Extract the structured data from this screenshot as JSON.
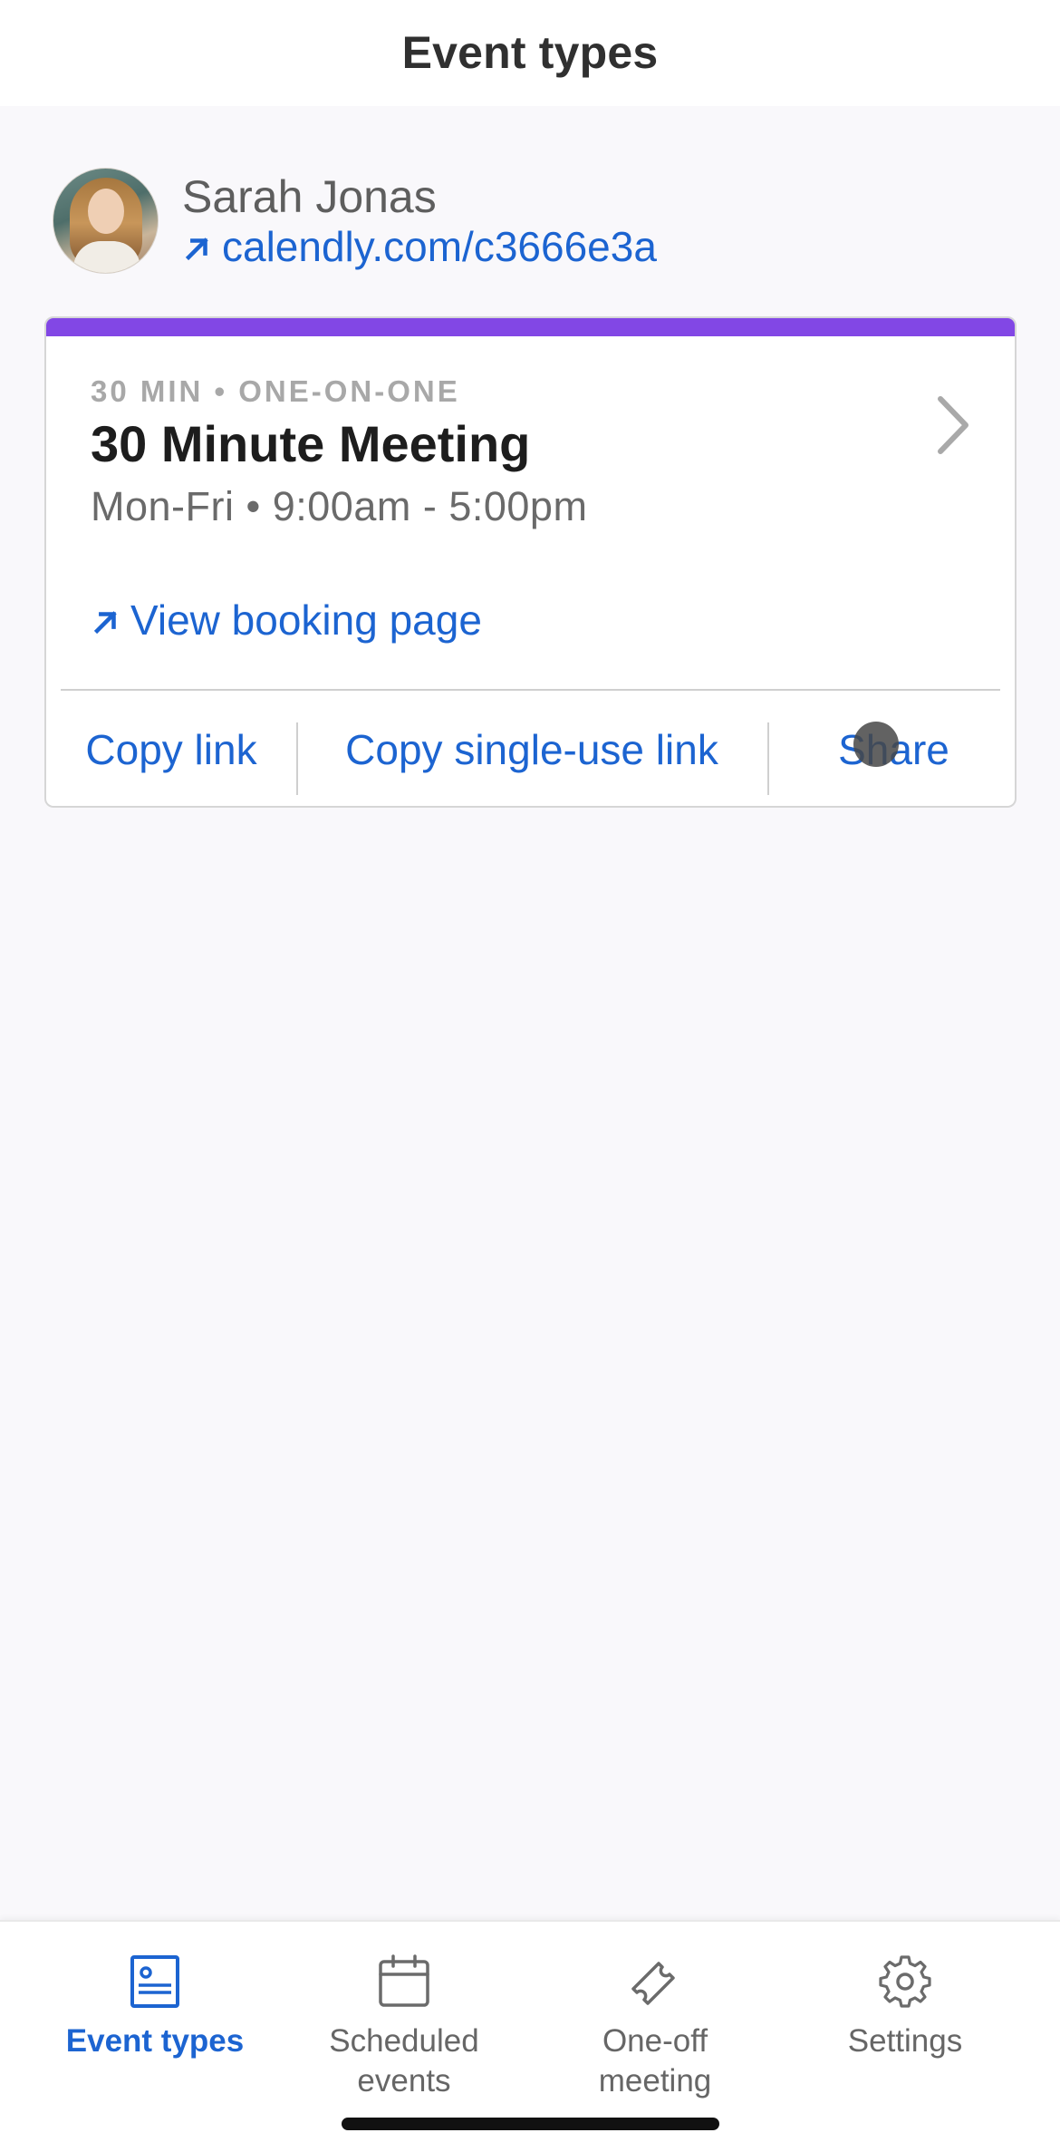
{
  "header": {
    "title": "Event types"
  },
  "profile": {
    "name": "Sarah Jonas",
    "link": "calendly.com/c3666e3a"
  },
  "event_card": {
    "accent_color": "#8247e5",
    "meta": "30 MIN • ONE-ON-ONE",
    "title": "30 Minute Meeting",
    "hours": "Mon-Fri • 9:00am - 5:00pm",
    "view_booking": "View booking page",
    "actions": {
      "copy_link": "Copy link",
      "copy_single_use": "Copy single-use link",
      "share": "Share"
    }
  },
  "tabbar": {
    "tabs": [
      {
        "label": "Event types",
        "icon": "event-types-icon",
        "active": true
      },
      {
        "label": "Scheduled\nevents",
        "icon": "calendar-icon",
        "active": false
      },
      {
        "label": "One-off\nmeeting",
        "icon": "ticket-icon",
        "active": false
      },
      {
        "label": "Settings",
        "icon": "gear-icon",
        "active": false
      }
    ]
  },
  "colors": {
    "link_blue": "#1c64d1",
    "accent_purple": "#8247e5",
    "background": "#f9f8fb"
  }
}
